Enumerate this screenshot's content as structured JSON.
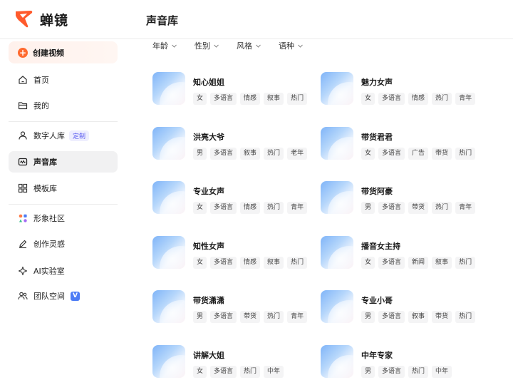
{
  "app": {
    "name": "蝉镜",
    "page_title": "声音库",
    "brand_color": "#ff5a2c"
  },
  "sidebar": {
    "create_button": "创建视频",
    "items": [
      {
        "label": "首页",
        "icon": "home-icon"
      },
      {
        "label": "我的",
        "icon": "folder-icon"
      },
      {
        "label": "数字人库",
        "icon": "person-icon",
        "badge": "定制"
      },
      {
        "label": "声音库",
        "icon": "sound-library-icon",
        "active": true
      },
      {
        "label": "模板库",
        "icon": "template-icon"
      },
      {
        "label": "形象社区",
        "icon": "community-icon"
      },
      {
        "label": "创作灵感",
        "icon": "pen-icon"
      },
      {
        "label": "AI实验室",
        "icon": "ai-lab-icon"
      },
      {
        "label": "团队空间",
        "icon": "team-icon",
        "badge": "V"
      }
    ]
  },
  "filters": [
    {
      "label": "年龄"
    },
    {
      "label": "性别"
    },
    {
      "label": "风格"
    },
    {
      "label": "语种"
    }
  ],
  "voices": [
    {
      "name": "知心姐姐",
      "tags": [
        "女",
        "多语言",
        "情感",
        "叙事",
        "热门"
      ]
    },
    {
      "name": "魅力女声",
      "tags": [
        "女",
        "多语言",
        "情感",
        "热门",
        "青年"
      ]
    },
    {
      "name": "洪亮大爷",
      "tags": [
        "男",
        "多语言",
        "叙事",
        "热门",
        "老年"
      ]
    },
    {
      "name": "带货君君",
      "tags": [
        "女",
        "多语言",
        "广告",
        "带货",
        "热门"
      ]
    },
    {
      "name": "专业女声",
      "tags": [
        "女",
        "多语言",
        "情感",
        "热门",
        "青年"
      ]
    },
    {
      "name": "带货阿豪",
      "tags": [
        "男",
        "多语言",
        "带货",
        "热门",
        "青年"
      ]
    },
    {
      "name": "知性女声",
      "tags": [
        "女",
        "多语言",
        "情感",
        "叙事",
        "热门"
      ]
    },
    {
      "name": "播音女主持",
      "tags": [
        "女",
        "多语言",
        "新闻",
        "叙事",
        "热门"
      ]
    },
    {
      "name": "带货潇潇",
      "tags": [
        "男",
        "多语言",
        "带货",
        "热门",
        "青年"
      ]
    },
    {
      "name": "专业小哥",
      "tags": [
        "男",
        "多语言",
        "叙事",
        "带货",
        "热门"
      ]
    },
    {
      "name": "讲解大姐",
      "tags": [
        "女",
        "多语言",
        "热门",
        "中年"
      ]
    },
    {
      "name": "中年专家",
      "tags": [
        "男",
        "多语言",
        "热门",
        "中年"
      ]
    }
  ]
}
